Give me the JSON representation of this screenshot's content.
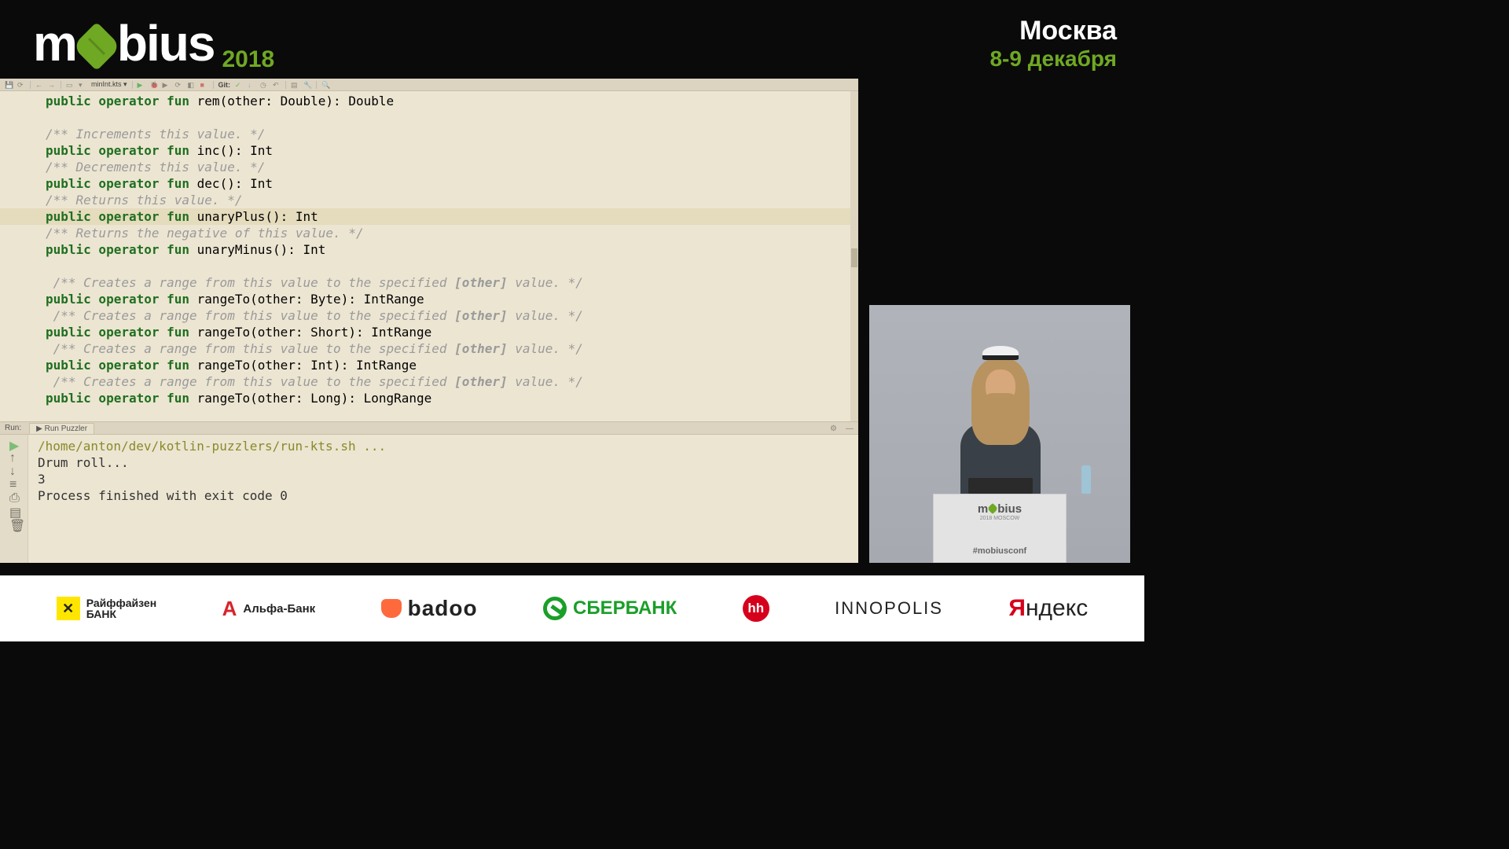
{
  "header": {
    "logo_prefix": "m",
    "logo_suffix": "bius",
    "year": "2018",
    "city": "Москва",
    "date": "8-9 декабря"
  },
  "toolbar": {
    "filename": "minInt.kts",
    "vcs_label": "Git:"
  },
  "code": {
    "l0_kw": "public operator fun",
    "l0_rest": " rem(other: Double): Double",
    "c1": "/** Increments this value. */",
    "l1_kw": "public operator fun",
    "l1_rest": " inc(): Int",
    "c2": "/** Decrements this value. */",
    "l2_kw": "public operator fun",
    "l2_rest": " dec(): Int",
    "c3": "/** Returns this value. */",
    "l3_kw": "public operator fun",
    "l3_rest": " unaryPlus(): Int",
    "c4": "/** Returns the negative of this value. */",
    "l4_kw": "public operator fun",
    "l4_rest": " unaryMinus(): Int",
    "cr_pre": " /** Creates a range from this value to the specified ",
    "cr_other": "[other]",
    "cr_post": " value. */",
    "r1_kw": "public operator fun",
    "r1_rest": " rangeTo(other: Byte): IntRange",
    "r2_kw": "public operator fun",
    "r2_rest": " rangeTo(other: Short): IntRange",
    "r3_kw": "public operator fun",
    "r3_rest": " rangeTo(other: Int): IntRange",
    "r4_kw": "public operator fun",
    "r4_rest": " rangeTo(other: Long): LongRange"
  },
  "run": {
    "label": "Run:",
    "tab": "Run Puzzler",
    "line1": "/home/anton/dev/kotlin-puzzlers/run-kts.sh ...",
    "line2": "Drum roll...",
    "line3": "3",
    "line4": "Process finished with exit code 0"
  },
  "podium": {
    "brand_prefix": "m",
    "brand_suffix": "bius",
    "subline": "2018 MOSCOW",
    "hashtag": "#mobiusconf"
  },
  "sponsors": {
    "raif_l1": "Райффайзен",
    "raif_l2": "БАНК",
    "alfa": "Альфа-Банк",
    "badoo": "badoo",
    "sber": "СБЕРБАНК",
    "hh": "hh",
    "inno": "innopolis",
    "yandex_y": "Я",
    "yandex_rest": "ндекс"
  }
}
